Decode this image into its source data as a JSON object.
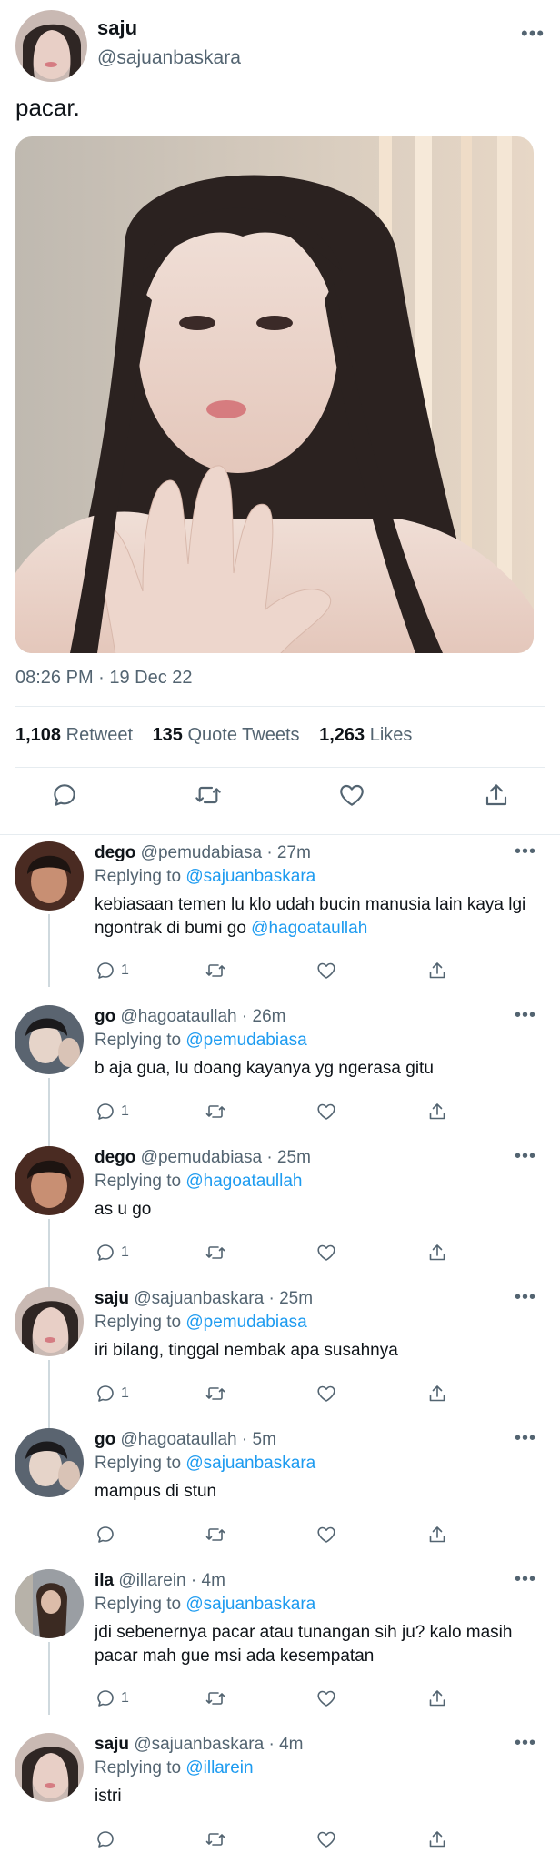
{
  "main_tweet": {
    "name": "saju",
    "handle": "@sajuanbaskara",
    "text": "pacar.",
    "timestamp": "08:26 PM · 19 Dec 22",
    "stats": [
      {
        "count": "1,108",
        "label": "Retweet"
      },
      {
        "count": "135",
        "label": "Quote Tweets"
      },
      {
        "count": "1,263",
        "label": "Likes"
      }
    ],
    "more_label": "•••"
  },
  "replies": [
    {
      "name": "dego",
      "handle": "@pemudabiasa",
      "time": "· 27m",
      "replying_prefix": "Replying to",
      "replying_to": "@sajuanbaskara",
      "text": "kebiasaan temen lu klo udah bucin manusia lain kaya lgi ngontrak di bumi go",
      "mention": "@hagoataullah",
      "reply_count": "1"
    },
    {
      "name": "go",
      "handle": "@hagoataullah",
      "time": "· 26m",
      "replying_prefix": "Replying to",
      "replying_to": "@pemudabiasa",
      "text": "b aja gua, lu doang kayanya yg ngerasa gitu",
      "mention": "",
      "reply_count": "1"
    },
    {
      "name": "dego",
      "handle": "@pemudabiasa",
      "time": "· 25m",
      "replying_prefix": "Replying to",
      "replying_to": "@hagoataullah",
      "text": "as u go",
      "mention": "",
      "reply_count": "1"
    },
    {
      "name": "saju",
      "handle": "@sajuanbaskara",
      "time": "· 25m",
      "replying_prefix": "Replying to",
      "replying_to": "@pemudabiasa",
      "text": "iri bilang, tinggal nembak apa susahnya",
      "mention": "",
      "reply_count": "1"
    },
    {
      "name": "go",
      "handle": "@hagoataullah",
      "time": "· 5m",
      "replying_prefix": "Replying to",
      "replying_to": "@sajuanbaskara",
      "text": "mampus di stun",
      "mention": "",
      "reply_count": ""
    },
    {
      "name": "ila",
      "handle": "@illarein",
      "time": "· 4m",
      "replying_prefix": "Replying to",
      "replying_to": "@sajuanbaskara",
      "text": "jdi sebenernya pacar atau tunangan sih ju? kalo masih pacar mah gue msi ada kesempatan",
      "mention": "",
      "reply_count": "1"
    },
    {
      "name": "saju",
      "handle": "@sajuanbaskara",
      "time": "· 4m",
      "replying_prefix": "Replying to",
      "replying_to": "@illarein",
      "text": "istri",
      "mention": "",
      "reply_count": ""
    }
  ],
  "colors": {
    "link": "#1d9bf0",
    "secondary_text": "#536471",
    "divider": "#e6ecf0"
  }
}
